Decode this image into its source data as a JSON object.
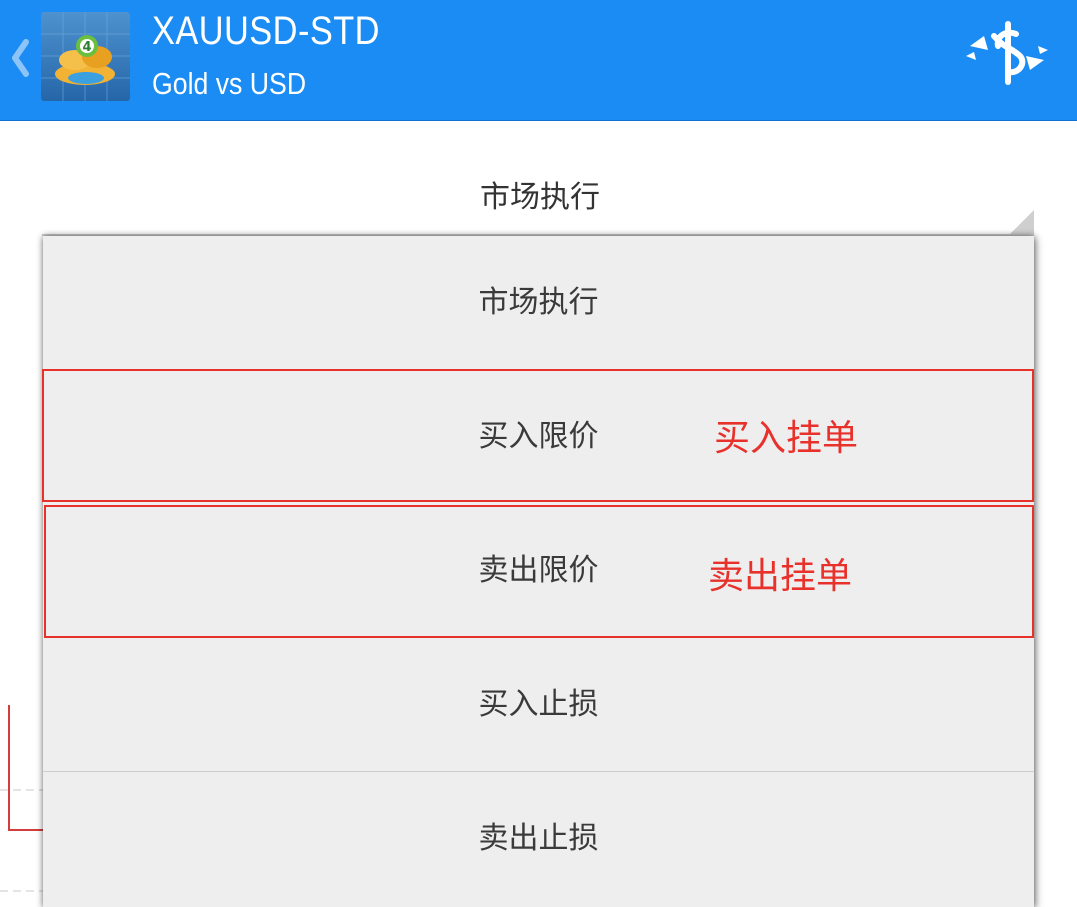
{
  "header": {
    "title": "XAUUSD-STD",
    "subtitle": "Gold vs USD",
    "logo_icon": "metatrader-4-logo-icon",
    "back_icon": "chevron-left-icon",
    "trade_icon": "dollar-exchange-icon",
    "bar_color": "#1a8cf3"
  },
  "order_type": {
    "selected": "市场执行",
    "options": [
      {
        "label": "市场执行"
      },
      {
        "label": "买入限价"
      },
      {
        "label": "卖出限价"
      },
      {
        "label": "买入止损"
      },
      {
        "label": "卖出止损"
      }
    ]
  },
  "annotations": {
    "buy_pending": "买入挂单",
    "sell_pending": "卖出挂单",
    "color": "#e8312b"
  }
}
